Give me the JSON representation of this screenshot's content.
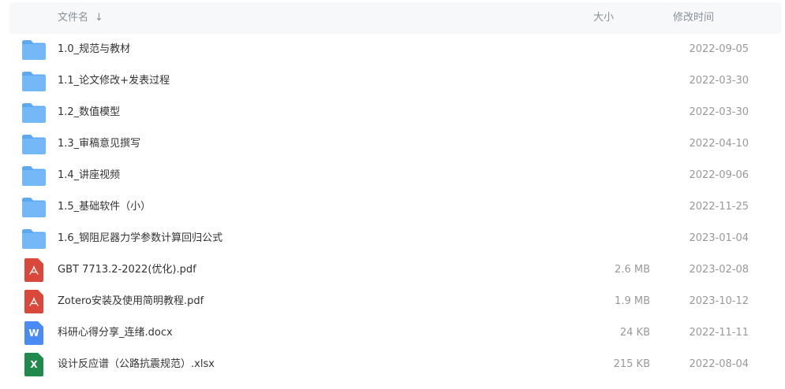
{
  "header": {
    "name_label": "文件名",
    "sort_icon": "arrow-down-icon",
    "size_label": "大小",
    "date_label": "修改时间"
  },
  "colors": {
    "folder": "#75b8f7",
    "folder_tab": "#5ea8f2",
    "pdf": "#d9483b",
    "word": "#4a8af4",
    "excel": "#1f8a4c",
    "header_bg": "#f7f8fa"
  },
  "files": [
    {
      "name": "1.0_规范与教材",
      "type": "folder",
      "icon": "folder-icon",
      "size": "",
      "date": "2022-09-05"
    },
    {
      "name": "1.1_论文修改+发表过程",
      "type": "folder",
      "icon": "folder-icon",
      "size": "",
      "date": "2022-03-30"
    },
    {
      "name": "1.2_数值模型",
      "type": "folder",
      "icon": "folder-icon",
      "size": "",
      "date": "2022-03-30"
    },
    {
      "name": "1.3_审稿意见撰写",
      "type": "folder",
      "icon": "folder-icon",
      "size": "",
      "date": "2022-04-10"
    },
    {
      "name": "1.4_讲座视频",
      "type": "folder",
      "icon": "folder-icon",
      "size": "",
      "date": "2022-09-06"
    },
    {
      "name": "1.5_基础软件（小）",
      "type": "folder",
      "icon": "folder-icon",
      "size": "",
      "date": "2022-11-25"
    },
    {
      "name": "1.6_钢阻尼器力学参数计算回归公式",
      "type": "folder",
      "icon": "folder-icon",
      "size": "",
      "date": "2023-01-04"
    },
    {
      "name": "GBT 7713.2-2022(优化).pdf",
      "type": "pdf",
      "icon": "pdf-file-icon",
      "size": "2.6 MB",
      "date": "2023-02-08"
    },
    {
      "name": "Zotero安装及使用简明教程.pdf",
      "type": "pdf",
      "icon": "pdf-file-icon",
      "size": "1.9 MB",
      "date": "2023-10-12"
    },
    {
      "name": "科研心得分享_连绪.docx",
      "type": "word",
      "icon": "word-file-icon",
      "size": "24 KB",
      "date": "2022-11-11",
      "badge": "W"
    },
    {
      "name": "设计反应谱（公路抗震规范）.xlsx",
      "type": "excel",
      "icon": "excel-file-icon",
      "size": "215 KB",
      "date": "2022-08-04",
      "badge": "X"
    }
  ]
}
